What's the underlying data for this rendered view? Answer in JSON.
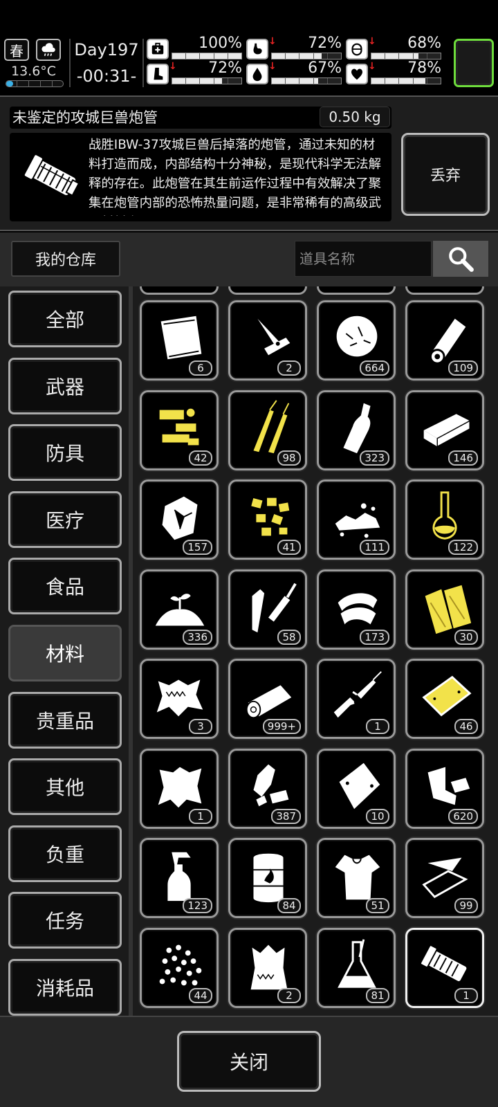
{
  "status": {
    "season": "春",
    "weather_icon": "cloud-rain-icon",
    "temperature": "13.6°C",
    "temperature_level": 0.12,
    "day": "Day197",
    "clock": "-00:31-",
    "stats": [
      {
        "name": "health",
        "icon": "medkit-icon",
        "value": "100%",
        "level": 1.0,
        "falling": false
      },
      {
        "name": "hunger",
        "icon": "stomach-icon",
        "value": "72%",
        "level": 0.72,
        "falling": true
      },
      {
        "name": "stamina",
        "icon": "lungs-icon",
        "value": "68%",
        "level": 0.68,
        "falling": true
      },
      {
        "name": "legs",
        "icon": "boot-icon",
        "value": "72%",
        "level": 0.72,
        "falling": true
      },
      {
        "name": "thirst",
        "icon": "water-drop-icon",
        "value": "67%",
        "level": 0.67,
        "falling": true
      },
      {
        "name": "mood",
        "icon": "heart-icon",
        "value": "78%",
        "level": 0.78,
        "falling": true
      }
    ],
    "accent_color": "#6edc3c",
    "drop_color": "#e22222"
  },
  "detail": {
    "name": "未鉴定的攻城巨兽炮管",
    "weight": "0.50 kg",
    "description": "战胜IBW-37攻城巨兽后掉落的炮管，通过未知的材料打造而成，内部结构十分神秘，是现代科学无法解释的存在。此炮管在其生前运作过程中有效解决了聚集在炮管内部的恐怖热量问题，是非常稀有的高级武器材料之",
    "discard_label": "丢弃"
  },
  "search": {
    "warehouse_label": "我的仓库",
    "placeholder": "道具名称"
  },
  "categories": [
    {
      "label": "全部",
      "active": false
    },
    {
      "label": "武器",
      "active": false
    },
    {
      "label": "防具",
      "active": false
    },
    {
      "label": "医疗",
      "active": false
    },
    {
      "label": "食品",
      "active": false
    },
    {
      "label": "材料",
      "active": true
    },
    {
      "label": "贵重品",
      "active": false
    },
    {
      "label": "其他",
      "active": false
    },
    {
      "label": "负重",
      "active": false
    },
    {
      "label": "任务",
      "active": false
    },
    {
      "label": "消耗品",
      "active": false
    }
  ],
  "items": [
    {
      "icon": "cloth-sheet-icon",
      "count": "6",
      "color": "#ffffff"
    },
    {
      "icon": "pocket-knife-icon",
      "count": "2",
      "color": "#ffffff"
    },
    {
      "icon": "fiber-tuft-icon",
      "count": "664",
      "color": "#ffffff"
    },
    {
      "icon": "paper-roll-icon",
      "count": "109",
      "color": "#ffffff"
    },
    {
      "icon": "gold-parts-icon",
      "count": "42",
      "color": "#f2e24a"
    },
    {
      "icon": "gold-wires-icon",
      "count": "98",
      "color": "#f2e24a"
    },
    {
      "icon": "bottle-icon",
      "count": "323",
      "color": "#ffffff"
    },
    {
      "icon": "brick-block-icon",
      "count": "146",
      "color": "#ffffff"
    },
    {
      "icon": "ore-chunk-icon",
      "count": "157",
      "color": "#ffffff"
    },
    {
      "icon": "gold-nuggets-icon",
      "count": "41",
      "color": "#f2e24a"
    },
    {
      "icon": "gravel-icon",
      "count": "111",
      "color": "#ffffff"
    },
    {
      "icon": "flask-icon",
      "count": "122",
      "color": "#f2e24a"
    },
    {
      "icon": "sprout-soil-icon",
      "count": "336",
      "color": "#ffffff"
    },
    {
      "icon": "soldering-tool-icon",
      "count": "58",
      "color": "#ffffff"
    },
    {
      "icon": "tape-roll-icon",
      "count": "173",
      "color": "#ffffff"
    },
    {
      "icon": "wood-planks-icon",
      "count": "30",
      "color": "#f2e24a"
    },
    {
      "icon": "fur-pelt-icon",
      "count": "3",
      "color": "#ffffff"
    },
    {
      "icon": "log-icon",
      "count": "999+",
      "color": "#ffffff"
    },
    {
      "icon": "broken-rifle-icon",
      "count": "1",
      "color": "#ffffff"
    },
    {
      "icon": "gold-plate-icon",
      "count": "46",
      "color": "#f2e24a"
    },
    {
      "icon": "leather-hide-icon",
      "count": "1",
      "color": "#ffffff"
    },
    {
      "icon": "plastic-bottle-icon",
      "count": "387",
      "color": "#ffffff"
    },
    {
      "icon": "metal-sheet-icon",
      "count": "10",
      "color": "#ffffff"
    },
    {
      "icon": "scrap-metal-icon",
      "count": "620",
      "color": "#ffffff"
    },
    {
      "icon": "spray-bottle-icon",
      "count": "123",
      "color": "#ffffff"
    },
    {
      "icon": "oil-barrel-icon",
      "count": "84",
      "color": "#ffffff"
    },
    {
      "icon": "torn-shirt-icon",
      "count": "51",
      "color": "#ffffff"
    },
    {
      "icon": "glass-shards-icon",
      "count": "99",
      "color": "#ffffff"
    },
    {
      "icon": "beads-icon",
      "count": "44",
      "color": "#ffffff"
    },
    {
      "icon": "sack-icon",
      "count": "2",
      "color": "#ffffff"
    },
    {
      "icon": "beaker-icon",
      "count": "81",
      "color": "#ffffff"
    },
    {
      "icon": "cannon-barrel-icon",
      "count": "1",
      "color": "#ffffff",
      "selected": true
    }
  ],
  "close_label": "关闭"
}
